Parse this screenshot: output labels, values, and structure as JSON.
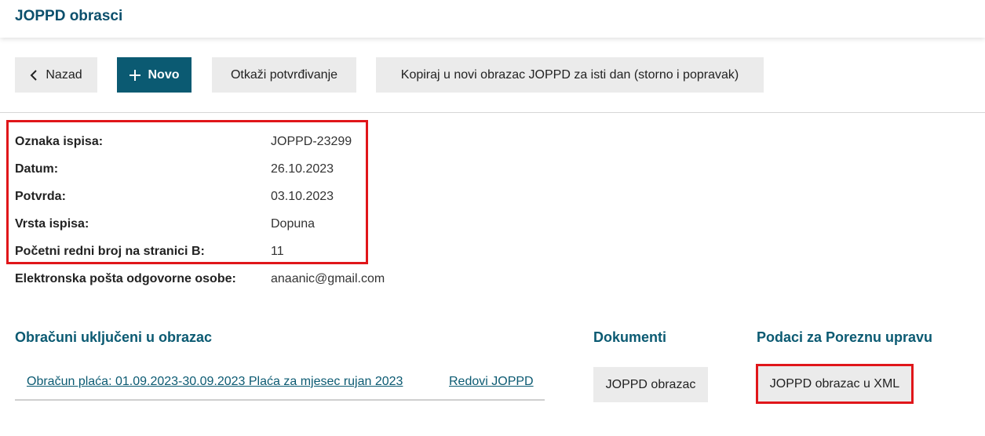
{
  "header": {
    "title": "JOPPD obrasci"
  },
  "toolbar": {
    "back_label": "Nazad",
    "new_label": "Novo",
    "cancel_confirm_label": "Otkaži potvrđivanje",
    "copy_label": "Kopiraj u novi obrazac JOPPD za isti dan (storno i popravak)"
  },
  "details": {
    "rows": [
      {
        "label": "Oznaka ispisa:",
        "value": "JOPPD-23299"
      },
      {
        "label": "Datum:",
        "value": "26.10.2023"
      },
      {
        "label": "Potvrda:",
        "value": "03.10.2023"
      },
      {
        "label": "Vrsta ispisa:",
        "value": "Dopuna"
      },
      {
        "label": "Početni redni broj na stranici B:",
        "value": "11"
      },
      {
        "label": "Elektronska pošta odgovorne osobe:",
        "value": "anaanic@gmail.com"
      }
    ]
  },
  "sections": {
    "calculations": {
      "title": "Obračuni uključeni u obrazac",
      "item_label": "Obračun plaća: 01.09.2023-30.09.2023 Plaća za mjesec rujan 2023",
      "rows_label": "Redovi JOPPD"
    },
    "documents": {
      "title": "Dokumenti",
      "button_label": "JOPPD obrazac"
    },
    "tax": {
      "title": "Podaci za Poreznu upravu",
      "button_label": "JOPPD obrazac u XML"
    }
  },
  "colors": {
    "accent": "#0b5a72",
    "highlight": "#e0161a"
  }
}
